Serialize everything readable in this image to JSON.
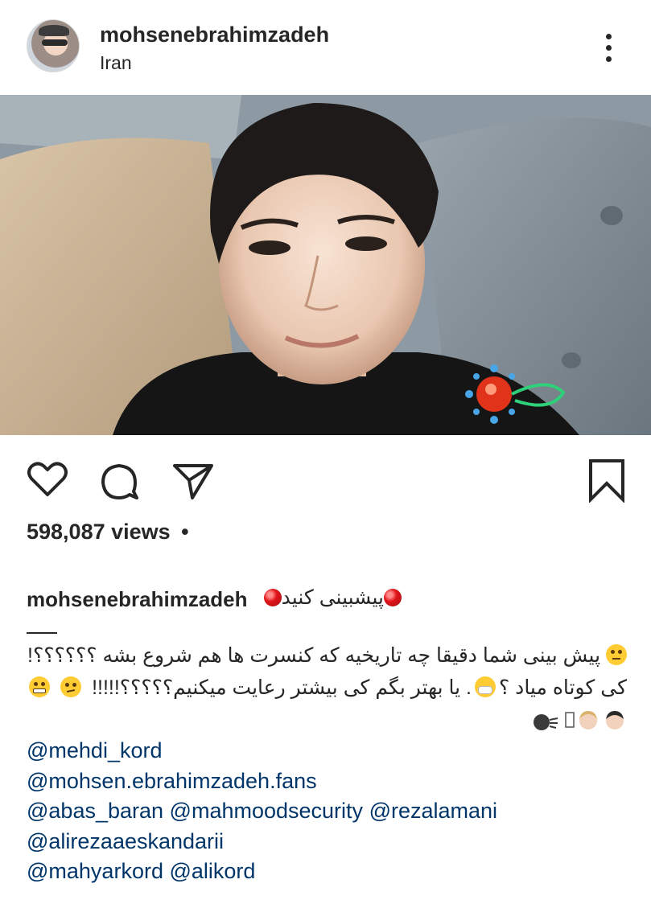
{
  "post": {
    "author": {
      "username": "mohsenebrahimzadeh",
      "location": "Iran",
      "avatar_icon": "profile-avatar"
    },
    "media": {
      "type": "video"
    },
    "actions": {
      "like_icon": "heart-outline-icon",
      "comment_icon": "comment-bubble-icon",
      "share_icon": "paper-plane-icon",
      "save_icon": "bookmark-outline-icon"
    },
    "views_label": "598,087 views",
    "views_separator": "•",
    "caption": {
      "username": "mohsenebrahimzadeh",
      "title": "پیشبینی کنید",
      "line1": "پیش بینی شما دقیقا چه تاریخیه که کنسرت ها هم شروع بشه ؟؟؟؟؟؟!",
      "line2_a": "کی کوتاه میاد ؟",
      "line2_b": ". یا بهتر بگم کی بیشتر رعایت میکنیم؟؟؟؟؟!!!!!"
    },
    "mention_lines": [
      [
        "@mehdi_kord"
      ],
      [
        "@mohsen.ebrahimzadeh.fans"
      ],
      [
        "@abas_baran",
        "@mahmoodsecurity",
        "@rezalamani"
      ],
      [
        "@alirezaaeskandarii"
      ],
      [
        "@mahyarkord",
        "@alikord"
      ]
    ],
    "colors": {
      "text": "#262626",
      "mention": "#003569",
      "accent_red": "#e0151a"
    }
  }
}
